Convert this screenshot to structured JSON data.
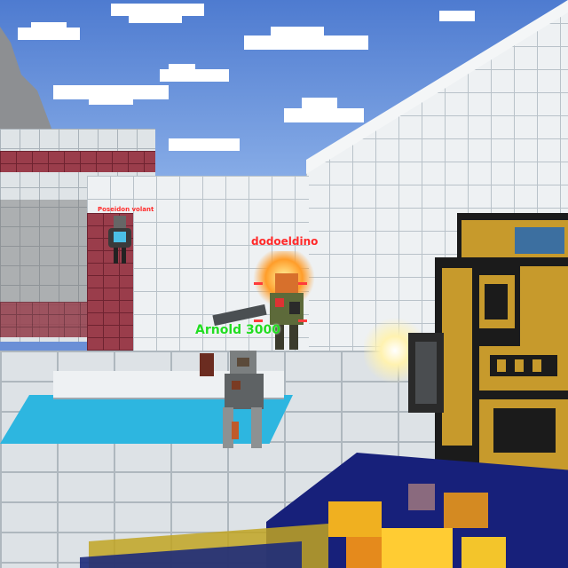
{
  "players": {
    "enemy_far_name": "Poseidon volant",
    "enemy_center_name": "dodoeldino",
    "ally_name": "Arnold 3000"
  },
  "colors": {
    "sky": "#6a8fd6",
    "enemy_name": "#ff2a2a",
    "ally_name": "#22dd22",
    "pool_water": "#2db6e0",
    "red_wall": "#9a3d4b",
    "weapon_gold": "#c79a2c",
    "weapon_dark": "#1b1b1b"
  },
  "icons": {
    "weapon": "pixel-gold-gun-icon",
    "pet": "robot-dog-icon"
  }
}
